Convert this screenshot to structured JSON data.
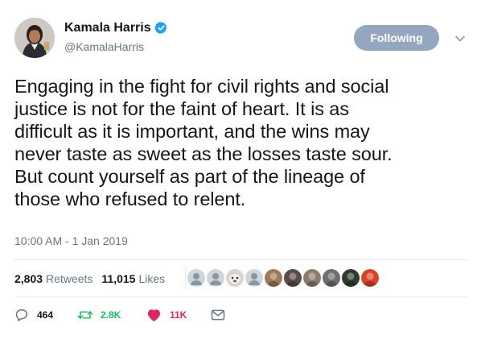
{
  "author": {
    "display_name": "Kamala Harris",
    "handle": "@KamalaHarris",
    "verified_icon": "verified-badge-icon",
    "verified_color": "#1da1f2"
  },
  "follow_button": {
    "label": "Following",
    "color": "#93a7c1"
  },
  "tweet": {
    "lines": [
      "Engaging in the fight for civil rights and social",
      "justice is not for the faint of heart. It is as",
      "difficult as it is important, and the wins may",
      "never taste as sweet as the losses taste sour.",
      "But count yourself as part of the lineage of",
      "those who refused to relent."
    ],
    "timestamp": "10:00 AM - 1 Jan 2019"
  },
  "stats": {
    "retweets_count": "2,803",
    "retweets_label": "Retweets",
    "likes_count": "11,015",
    "likes_label": "Likes"
  },
  "likers": [
    {
      "icon": "default-avatar-icon",
      "color": "#ccd6dd"
    },
    {
      "icon": "default-avatar-icon",
      "color": "#ccd6dd"
    },
    {
      "icon": "animal-avatar-icon",
      "color": "#d9d4cc"
    },
    {
      "icon": "default-avatar-icon",
      "color": "#ccd6dd"
    },
    {
      "icon": "photo-avatar-icon",
      "color": "#9c7a5b"
    },
    {
      "icon": "photo-avatar-icon",
      "color": "#5a4a4a"
    },
    {
      "icon": "photo-avatar-icon",
      "color": "#8b7d6b"
    },
    {
      "icon": "photo-avatar-icon",
      "color": "#6f6f6f"
    },
    {
      "icon": "photo-avatar-icon",
      "color": "#2e3b2e"
    },
    {
      "icon": "photo-avatar-icon",
      "color": "#d9432a"
    }
  ],
  "actions": {
    "replies": "464",
    "retweets": "2.8K",
    "likes": "11K",
    "retweet_color": "#17bf63",
    "like_color": "#e0245e",
    "muted_color": "#657786"
  }
}
